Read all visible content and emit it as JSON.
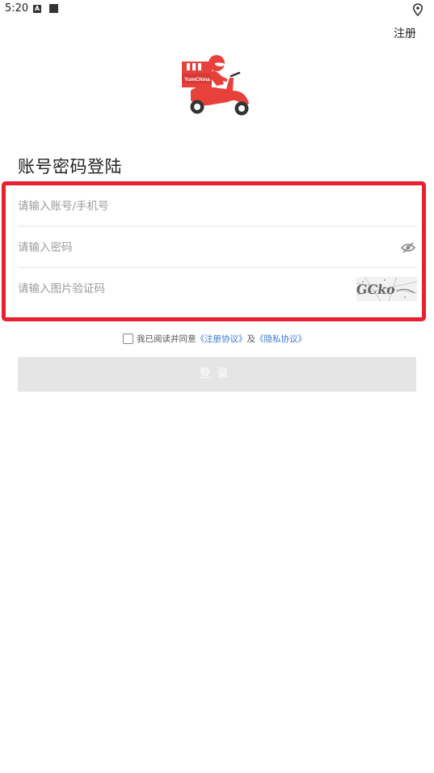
{
  "status_bar": {
    "time": "5:20",
    "notif_letter": "A"
  },
  "header": {
    "register_label": "注册"
  },
  "logo": {
    "brand_text": "YumChina",
    "colors": {
      "primary": "#e8413c",
      "dark": "#333333"
    }
  },
  "login": {
    "title": "账号密码登陆",
    "account_placeholder": "请输入账号/手机号",
    "password_placeholder": "请输入密码",
    "captcha_placeholder": "请输入图片验证码",
    "captcha_text": "GCko",
    "agree_prefix": "我已阅读并同意",
    "register_agreement": "《注册协议》",
    "and": "及",
    "privacy_agreement": "《隐私协议》",
    "login_button": "登录"
  },
  "highlight_color": "#e8202f"
}
